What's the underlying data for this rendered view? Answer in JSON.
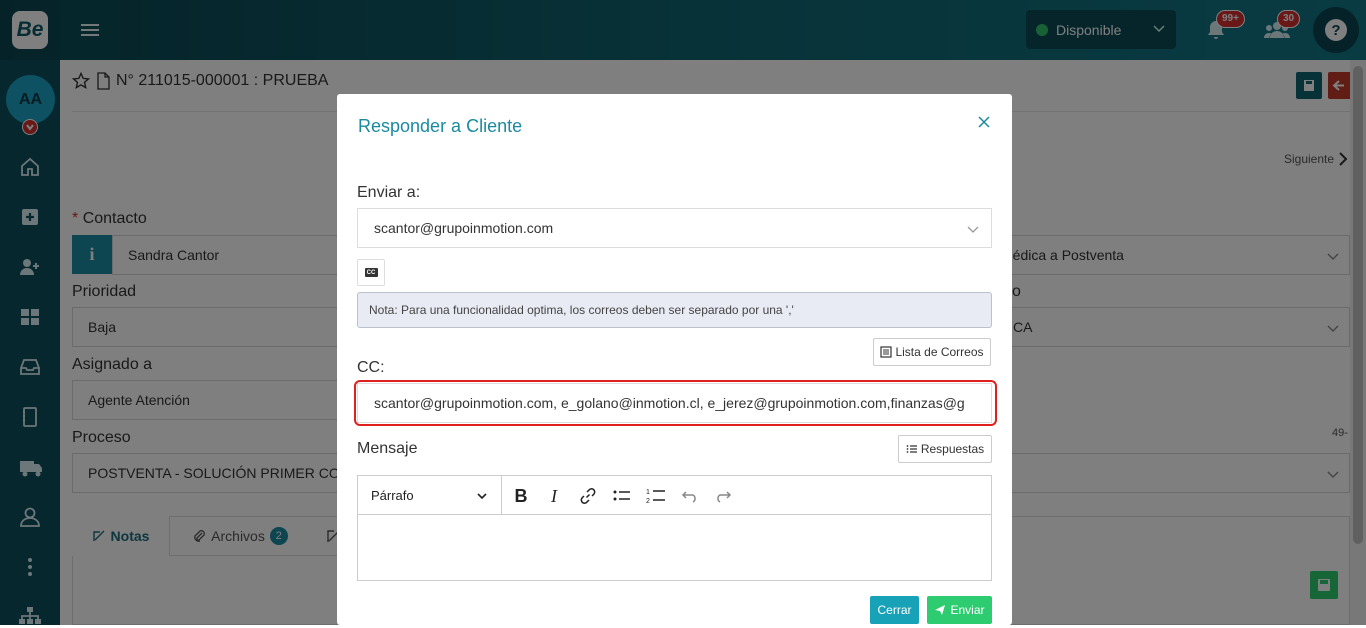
{
  "topbar": {
    "logo_text": "Be",
    "status_label": "Disponible",
    "notifications_badge": "99+",
    "users_badge": "30",
    "help_label": "?"
  },
  "sidebar": {
    "avatar_initials": "AA"
  },
  "background": {
    "ticket_title": "N° 211015-000001 : PRUEBA",
    "siguiente": "Siguiente",
    "contacto_label": "Contacto",
    "required_mark": "*",
    "contacto_value": "Sandra Cantor",
    "prioridad_label": "Prioridad",
    "prioridad_value": "Baja",
    "asignado_label": "Asignado a",
    "asignado_value": "Agente Atención",
    "proceso_label": "Proceso",
    "proceso_value": "POSTVENTA - SOLUCIÓN PRIMER CON",
    "right_field_1": "médica a Postventa",
    "right_label_2": "o",
    "right_field_2": "CA",
    "right_num": "49-",
    "tab_notas": "Notas",
    "tab_archivos": "Archivos",
    "archivos_count": "2"
  },
  "modal": {
    "title": "Responder a Cliente",
    "enviar_label": "Enviar a:",
    "enviar_value": "scantor@grupoinmotion.com",
    "cc_small_label": "CC",
    "note": "Nota: Para una funcionalidad optima, los correos deben ser separado por una ','",
    "lista_correos": "Lista de Correos",
    "cc_label": "CC:",
    "cc_value": "scantor@grupoinmotion.com, e_golano@inmotion.cl, e_jerez@grupoinmotion.com,finanzas@g",
    "mensaje_label": "Mensaje",
    "respuestas": "Respuestas",
    "paragraph_select": "Párrafo",
    "btn_cerrar": "Cerrar",
    "btn_enviar": "Enviar"
  },
  "colors": {
    "accent": "#1a8aa0",
    "success": "#2ecc71",
    "info": "#17a2b8",
    "danger": "#e01f1f"
  }
}
